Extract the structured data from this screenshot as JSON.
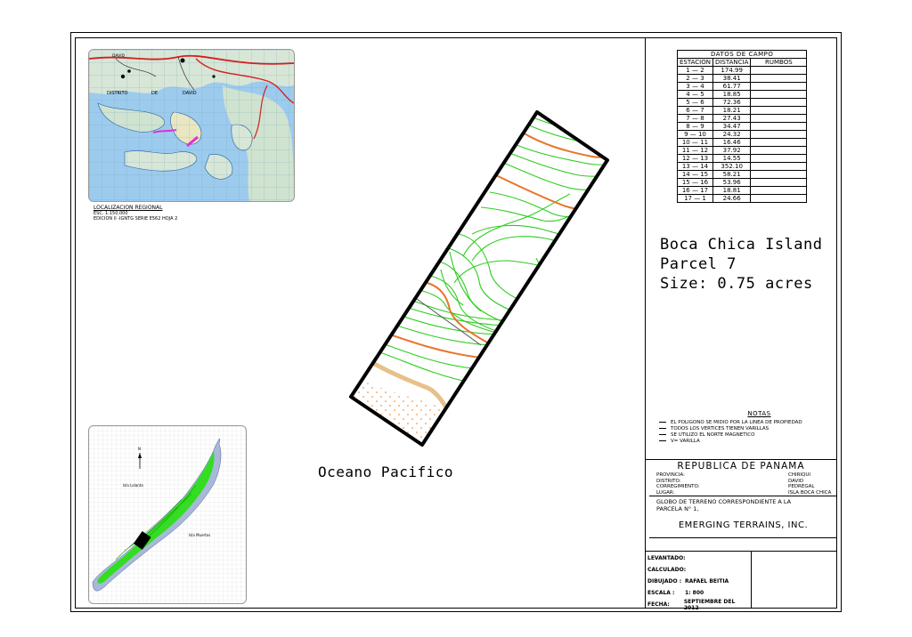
{
  "location_map": {
    "label_district": "DISTRITO",
    "label_de": "DE",
    "label_david": "DAVID",
    "label_david_top": "DAVID",
    "caption_title": "LOCALIZACION REGIONAL",
    "caption_scale": "ESC. 1:150,000",
    "caption_edition": "EDICION II -IGNTG SERIE E562 HOJA 2"
  },
  "island_map": {
    "label_west": "Isla Lolanta",
    "label_east": "Isla Muertos",
    "north_label": "N"
  },
  "field_table": {
    "title": "DATOS DE CAMPO",
    "headers": [
      "ESTACION",
      "DISTANCIA",
      "RUMBOS"
    ],
    "rows": [
      [
        "1 — 2",
        "174.99",
        ""
      ],
      [
        "2 — 3",
        "38.41",
        ""
      ],
      [
        "3 — 4",
        "61.77",
        ""
      ],
      [
        "4 — 5",
        "18.85",
        ""
      ],
      [
        "5 — 6",
        "72.36",
        ""
      ],
      [
        "6 — 7",
        "18.21",
        ""
      ],
      [
        "7 — 8",
        "27.43",
        ""
      ],
      [
        "8 — 9",
        "34.47",
        ""
      ],
      [
        "9 — 10",
        "24.32",
        ""
      ],
      [
        "10 — 11",
        "16.46",
        ""
      ],
      [
        "11 — 12",
        "37.92",
        ""
      ],
      [
        "12 — 13",
        "14.55",
        ""
      ],
      [
        "13 — 14",
        "352.10",
        ""
      ],
      [
        "14 — 15",
        "58.21",
        ""
      ],
      [
        "15 — 16",
        "53.96",
        ""
      ],
      [
        "16 — 17",
        "18.81",
        ""
      ],
      [
        "17 — 1",
        "24.66",
        ""
      ]
    ]
  },
  "parcel_info": {
    "line1": "Boca Chica Island",
    "line2": "Parcel 7",
    "line3": "Size: 0.75 acres"
  },
  "ocean_label": "Oceano Pacifico",
  "notes": {
    "title": "NOTAS",
    "items": [
      "EL POLIGONO SE MIDIO POR LA LINEA DE PROPIEDAD",
      "TODOS LOS VERTICES TIENEN VARILLAS",
      "SE UTILIZO EL NORTE MAGNETICO",
      "V= VARILLA"
    ]
  },
  "title_block": {
    "country": "REPUBLICA DE PANAMA",
    "fields": [
      {
        "label": "PROVINCIA:",
        "value": "CHIRIQUI"
      },
      {
        "label": "DISTRITO:",
        "value": "DAVID"
      },
      {
        "label": "CORREGIMIENTO:",
        "value": "PEDREGAL"
      },
      {
        "label": "LUGAR:",
        "value": "ISLA BOCA CHICA"
      }
    ],
    "description_line1": "GLOBO DE TERRENO CORRESPONDIENTE A LA",
    "description_line2": "PARCELA N° 1,",
    "company": "EMERGING TERRAINS, INC.",
    "signatures": [
      {
        "label": "LEVANTADO:",
        "value": ""
      },
      {
        "label": "CALCULADO:",
        "value": ""
      },
      {
        "label": "DIBUJADO :",
        "value": "RAFAEL BEITIA"
      },
      {
        "label": "ESCALA :",
        "value": "1: 800"
      },
      {
        "label": "FECHA:",
        "value": "SEPTIEMBRE DEL 2012"
      }
    ]
  },
  "colors": {
    "contour_green": "#2ecc1f",
    "contour_orange": "#e8742a",
    "sand_dots": "#f0b07a",
    "water_blue": "#5aa6e0",
    "island_green": "#33dd22"
  }
}
